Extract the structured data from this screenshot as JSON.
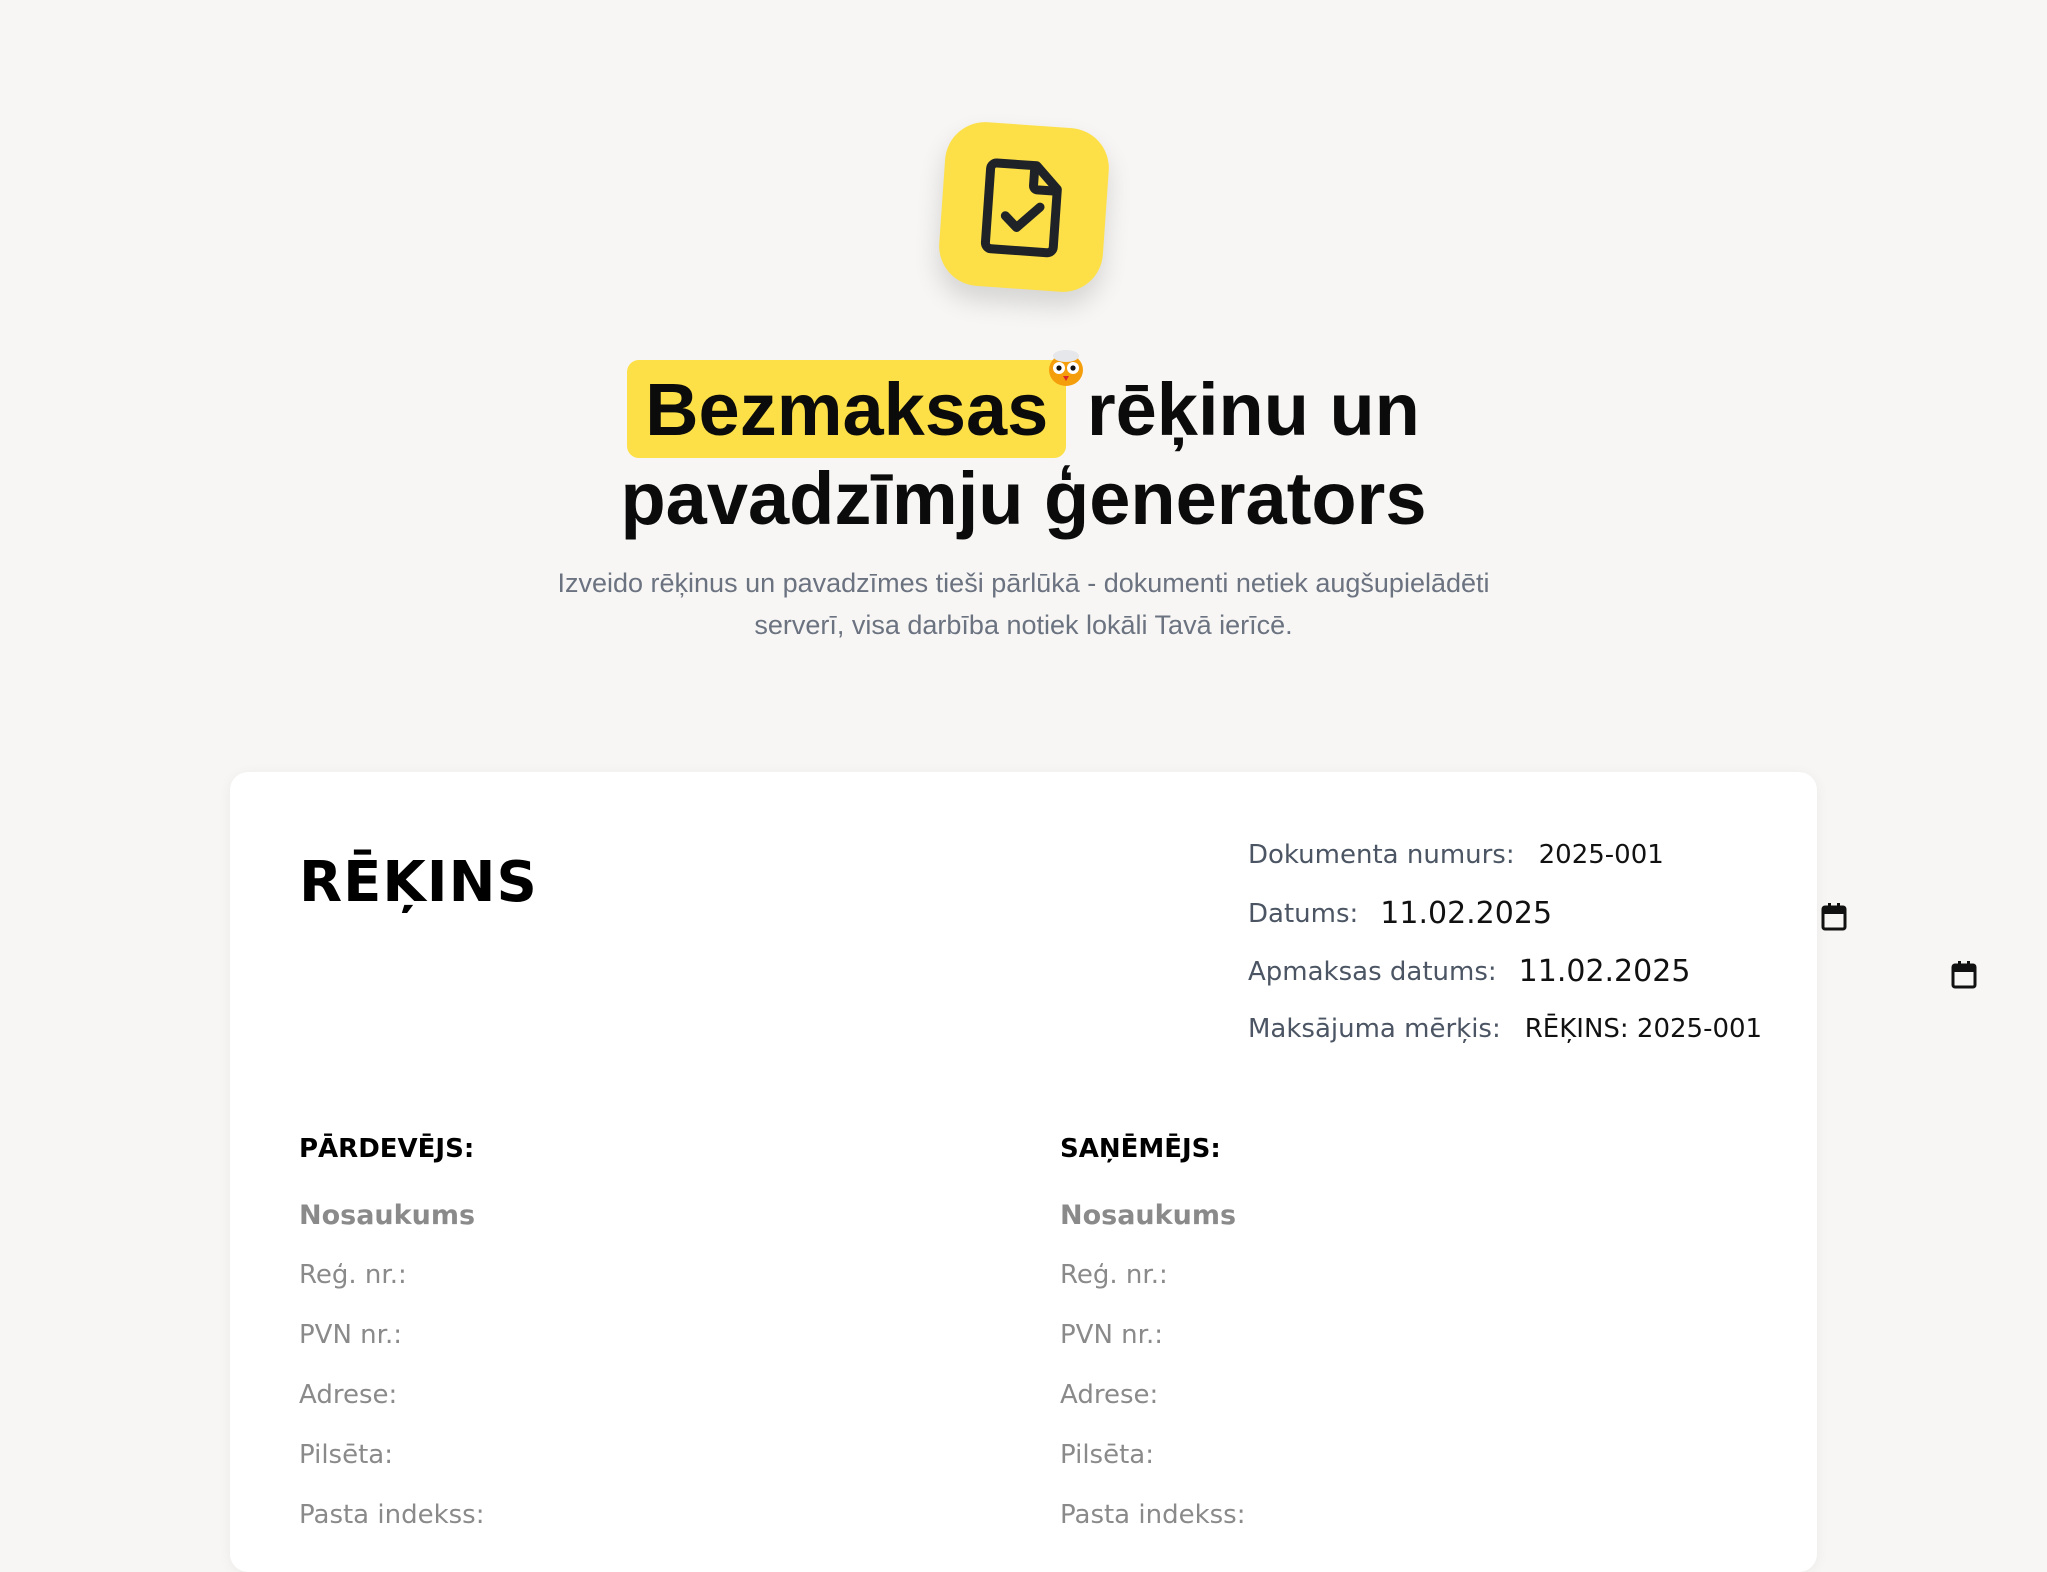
{
  "hero": {
    "logo_icon": "document-check-icon",
    "mascot_icon": "owl-icon",
    "accent_color": "#fde047",
    "headline_highlight": "Bezmaksas",
    "headline_line1_rest": "rēķinu un",
    "headline_line2": "pavadzīmju ģenerators",
    "subtitle": "Izveido rēķinus un pavadzīmes tieši pārlūkā - dokumenti netiek augšupielādēti serverī, visa darbība notiek lokāli Tavā ierīcē."
  },
  "document": {
    "title": "RĒĶINS",
    "meta": {
      "number_label": "Dokumenta numurs:",
      "number_value": "2025-001",
      "date_label": "Datums:",
      "date_value": "11.02.2025",
      "due_label": "Apmaksas datums:",
      "due_value": "11.02.2025",
      "purpose_label": "Maksājuma mērķis:",
      "purpose_value": "RĒĶINS: 2025-001",
      "calendar_icon": "calendar-icon"
    },
    "seller": {
      "heading": "PĀRDEVĒJS:",
      "name_placeholder": "Nosaukums",
      "reg_label": "Reģ. nr.:",
      "vat_label": "PVN nr.:",
      "address_label": "Adrese:",
      "city_label": "Pilsēta:",
      "postal_label": "Pasta indekss:"
    },
    "buyer": {
      "heading": "SAŅĒMĒJS:",
      "name_placeholder": "Nosaukums",
      "reg_label": "Reģ. nr.:",
      "vat_label": "PVN nr.:",
      "address_label": "Adrese:",
      "city_label": "Pilsēta:",
      "postal_label": "Pasta indekss:"
    }
  }
}
